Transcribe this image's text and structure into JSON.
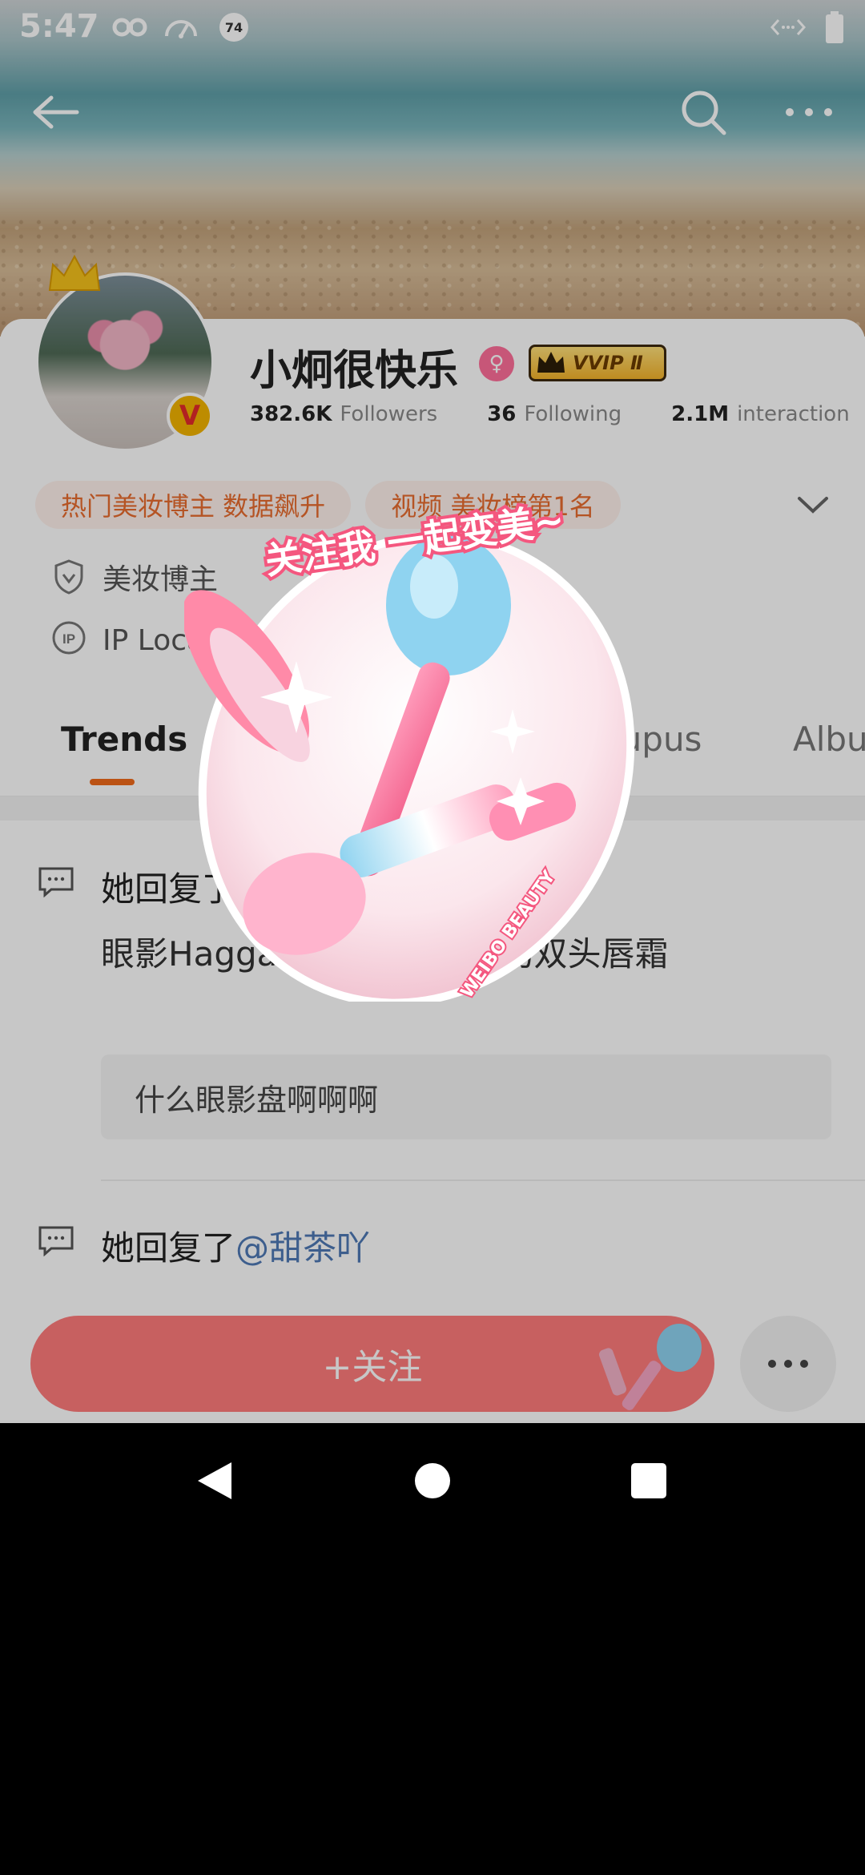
{
  "status_bar": {
    "time": "5:47",
    "notification_count": "74"
  },
  "profile": {
    "username": "小炯很快乐",
    "vip_label": "VVIP Ⅱ",
    "verified_mark": "V",
    "stats": [
      {
        "value": "382.6K",
        "label": "Followers"
      },
      {
        "value": "36",
        "label": "Following"
      },
      {
        "value": "2.1M",
        "label": "interaction"
      }
    ],
    "tags": [
      "热门美妆博主 数据飙升",
      "视频 美妆榜第1名"
    ],
    "category": "美妆博主",
    "ip_location": "IP Location:江"
  },
  "tabs": [
    "Trends",
    "Supus",
    "Albu"
  ],
  "feed": [
    {
      "title": "她回复了",
      "mention": "",
      "body": "眼影Haggard 红Haggard的双头唇霜",
      "quote": "什么眼影盘啊啊啊"
    },
    {
      "title": "她回复了",
      "mention": "@甜茶吖",
      "body": "",
      "quote": ""
    }
  ],
  "sticker": {
    "top_text": "关注我 一起变美~",
    "ring_text": "WEIBO BEAUTY"
  },
  "action_bar": {
    "follow_label": "+关注"
  }
}
